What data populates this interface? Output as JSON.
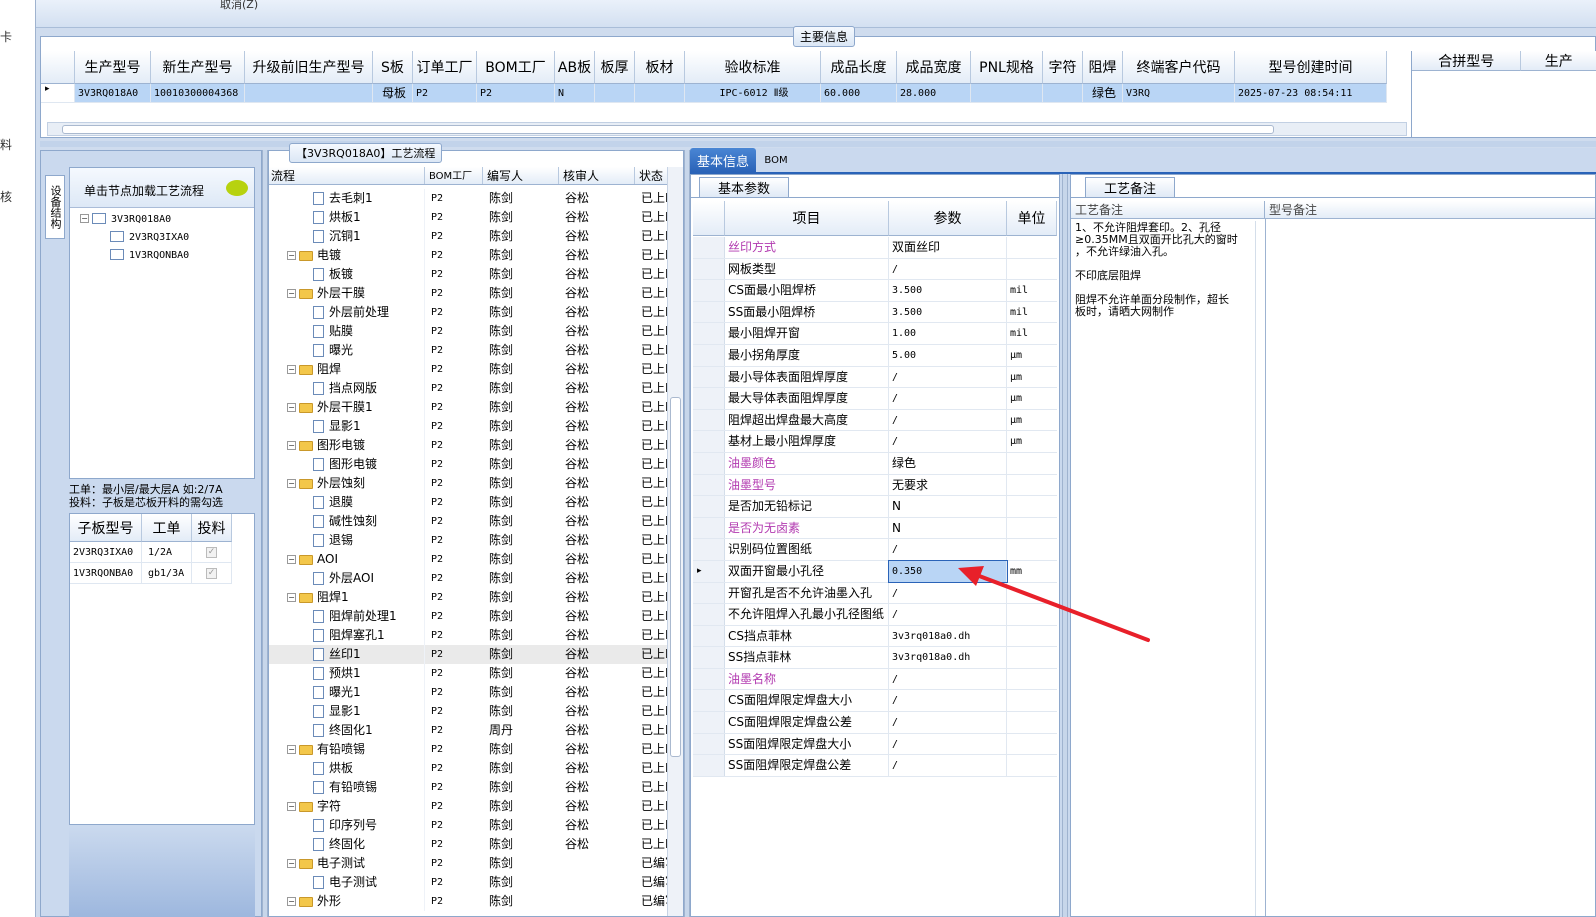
{
  "top": {
    "cancel_label": "取消(Z)"
  },
  "left_strip": {
    "items": [
      "卡",
      "料",
      "核"
    ]
  },
  "main_info": {
    "title": "主要信息",
    "columns": [
      "生产型号",
      "新生产型号",
      "升级前旧生产型号",
      "S板",
      "订单工厂",
      "BOM工厂",
      "AB板",
      "板厚",
      "板材",
      "验收标准",
      "成品长度",
      "成品宽度",
      "PNL规格",
      "字符",
      "阻焊",
      "终端客户代码",
      "型号创建时间"
    ],
    "row": [
      "3V3RQ018A0",
      "10010300004368",
      "",
      "母板",
      "P2",
      "P2",
      "N",
      "",
      "",
      "IPC-6012 Ⅱ级",
      "60.000",
      "28.000",
      "",
      "",
      "绿色",
      "V3RQ",
      "2025-07-23 08:54:11"
    ],
    "right_columns": [
      "合拼型号",
      "生产"
    ]
  },
  "left_panel": {
    "vtab": "设备结构",
    "load_hint": "单击节点加载工艺流程",
    "tree": [
      "3V3RQ018A0",
      "2V3RQ3IXA0",
      "1V3RQONBA0"
    ],
    "note_line1": "工单：最小层/最大层A 如:2/7A",
    "note_line2": "投料：子板是芯板开料的需勾选",
    "sub_headers": [
      "子板型号",
      "工单",
      "投料"
    ],
    "sub_rows": [
      {
        "model": "2V3RQ3IXA0",
        "order": "1/2A"
      },
      {
        "model": "1V3RQONBA0",
        "order": "gb1/3A"
      }
    ]
  },
  "flow": {
    "title": "【3V3RQ018A0】工艺流程",
    "headers": [
      "流程",
      "BOM工厂",
      "编写人",
      "核审人",
      "状态"
    ],
    "rows": [
      {
        "t": "d",
        "name": "去毛刺1",
        "bom": "P2",
        "w": "陈剑",
        "r": "谷松",
        "s": "已上R"
      },
      {
        "t": "d",
        "name": "烘板1",
        "bom": "P2",
        "w": "陈剑",
        "r": "谷松",
        "s": "已上R"
      },
      {
        "t": "d",
        "name": "沉铜1",
        "bom": "P2",
        "w": "陈剑",
        "r": "谷松",
        "s": "已上R"
      },
      {
        "t": "f",
        "name": "电镀",
        "bom": "P2",
        "w": "陈剑",
        "r": "谷松",
        "s": "已上R"
      },
      {
        "t": "d",
        "name": "板镀",
        "bom": "P2",
        "w": "陈剑",
        "r": "谷松",
        "s": "已上R"
      },
      {
        "t": "f",
        "name": "外层干膜",
        "bom": "P2",
        "w": "陈剑",
        "r": "谷松",
        "s": "已上R"
      },
      {
        "t": "d",
        "name": "外层前处理",
        "bom": "P2",
        "w": "陈剑",
        "r": "谷松",
        "s": "已上R"
      },
      {
        "t": "d",
        "name": "贴膜",
        "bom": "P2",
        "w": "陈剑",
        "r": "谷松",
        "s": "已上R"
      },
      {
        "t": "d",
        "name": "曝光",
        "bom": "P2",
        "w": "陈剑",
        "r": "谷松",
        "s": "已上R"
      },
      {
        "t": "f",
        "name": "阻焊",
        "bom": "P2",
        "w": "陈剑",
        "r": "谷松",
        "s": "已上R"
      },
      {
        "t": "d",
        "name": "挡点网版",
        "bom": "P2",
        "w": "陈剑",
        "r": "谷松",
        "s": "已上R"
      },
      {
        "t": "f",
        "name": "外层干膜1",
        "bom": "P2",
        "w": "陈剑",
        "r": "谷松",
        "s": "已上R"
      },
      {
        "t": "d",
        "name": "显影1",
        "bom": "P2",
        "w": "陈剑",
        "r": "谷松",
        "s": "已上R"
      },
      {
        "t": "f",
        "name": "图形电镀",
        "bom": "P2",
        "w": "陈剑",
        "r": "谷松",
        "s": "已上R"
      },
      {
        "t": "d",
        "name": "图形电镀",
        "bom": "P2",
        "w": "陈剑",
        "r": "谷松",
        "s": "已上R"
      },
      {
        "t": "f",
        "name": "外层蚀刻",
        "bom": "P2",
        "w": "陈剑",
        "r": "谷松",
        "s": "已上R"
      },
      {
        "t": "d",
        "name": "退膜",
        "bom": "P2",
        "w": "陈剑",
        "r": "谷松",
        "s": "已上R"
      },
      {
        "t": "d",
        "name": "碱性蚀刻",
        "bom": "P2",
        "w": "陈剑",
        "r": "谷松",
        "s": "已上R"
      },
      {
        "t": "d",
        "name": "退锡",
        "bom": "P2",
        "w": "陈剑",
        "r": "谷松",
        "s": "已上R"
      },
      {
        "t": "f",
        "name": "AOI",
        "bom": "P2",
        "w": "陈剑",
        "r": "谷松",
        "s": "已上R"
      },
      {
        "t": "d",
        "name": "外层AOI",
        "bom": "P2",
        "w": "陈剑",
        "r": "谷松",
        "s": "已上R"
      },
      {
        "t": "f",
        "name": "阻焊1",
        "bom": "P2",
        "w": "陈剑",
        "r": "谷松",
        "s": "已上R"
      },
      {
        "t": "d",
        "name": "阻焊前处理1",
        "bom": "P2",
        "w": "陈剑",
        "r": "谷松",
        "s": "已上R"
      },
      {
        "t": "d",
        "name": "阻焊塞孔1",
        "bom": "P2",
        "w": "陈剑",
        "r": "谷松",
        "s": "已上R"
      },
      {
        "t": "d",
        "name": "丝印1",
        "bom": "P2",
        "w": "陈剑",
        "r": "谷松",
        "s": "已上R",
        "sel": true
      },
      {
        "t": "d",
        "name": "预烘1",
        "bom": "P2",
        "w": "陈剑",
        "r": "谷松",
        "s": "已上R"
      },
      {
        "t": "d",
        "name": "曝光1",
        "bom": "P2",
        "w": "陈剑",
        "r": "谷松",
        "s": "已上R"
      },
      {
        "t": "d",
        "name": "显影1",
        "bom": "P2",
        "w": "陈剑",
        "r": "谷松",
        "s": "已上R"
      },
      {
        "t": "d",
        "name": "终固化1",
        "bom": "P2",
        "w": "周丹",
        "r": "谷松",
        "s": "已上R"
      },
      {
        "t": "f",
        "name": "有铅喷锡",
        "bom": "P2",
        "w": "陈剑",
        "r": "谷松",
        "s": "已上R"
      },
      {
        "t": "d",
        "name": "烘板",
        "bom": "P2",
        "w": "陈剑",
        "r": "谷松",
        "s": "已上R"
      },
      {
        "t": "d",
        "name": "有铅喷锡",
        "bom": "P2",
        "w": "陈剑",
        "r": "谷松",
        "s": "已上R"
      },
      {
        "t": "f",
        "name": "字符",
        "bom": "P2",
        "w": "陈剑",
        "r": "谷松",
        "s": "已上R"
      },
      {
        "t": "d",
        "name": "印序列号",
        "bom": "P2",
        "w": "陈剑",
        "r": "谷松",
        "s": "已上R"
      },
      {
        "t": "d",
        "name": "终固化",
        "bom": "P2",
        "w": "陈剑",
        "r": "谷松",
        "s": "已上R"
      },
      {
        "t": "f",
        "name": "电子测试",
        "bom": "P2",
        "w": "陈剑",
        "r": "",
        "s": "已编写"
      },
      {
        "t": "d",
        "name": "电子测试",
        "bom": "P2",
        "w": "陈剑",
        "r": "",
        "s": "已编写"
      },
      {
        "t": "f",
        "name": "外形",
        "bom": "P2",
        "w": "陈剑",
        "r": "",
        "s": "已编写"
      }
    ]
  },
  "info": {
    "tab_basic": "基本信息",
    "tab_bom": "BOM",
    "subtab": "基本参数",
    "headers": [
      "项目",
      "参数",
      "单位"
    ],
    "params": [
      {
        "name": "丝印方式",
        "value": "双面丝印",
        "unit": "",
        "hl": true
      },
      {
        "name": "网板类型",
        "value": "/",
        "unit": ""
      },
      {
        "name": "CS面最小阻焊桥",
        "value": "3.500",
        "unit": "mil"
      },
      {
        "name": "SS面最小阻焊桥",
        "value": "3.500",
        "unit": "mil"
      },
      {
        "name": "最小阻焊开窗",
        "value": "1.00",
        "unit": "mil"
      },
      {
        "name": "最小拐角厚度",
        "value": "5.00",
        "unit": "μm"
      },
      {
        "name": "最小导体表面阻焊厚度",
        "value": "/",
        "unit": "μm"
      },
      {
        "name": "最大导体表面阻焊厚度",
        "value": "/",
        "unit": "μm"
      },
      {
        "name": "阻焊超出焊盘最大高度",
        "value": "/",
        "unit": "μm"
      },
      {
        "name": "基材上最小阻焊厚度",
        "value": "/",
        "unit": "μm"
      },
      {
        "name": "油墨颜色",
        "value": "绿色",
        "unit": "",
        "hl": true
      },
      {
        "name": "油墨型号",
        "value": "无要求",
        "unit": "",
        "hl": true
      },
      {
        "name": "是否加无铅标记",
        "value": "N",
        "unit": ""
      },
      {
        "name": "是否为无卤素",
        "value": "N",
        "unit": "",
        "hl": true
      },
      {
        "name": "识别码位置图纸",
        "value": "/",
        "unit": ""
      },
      {
        "name": "双面开窗最小孔径",
        "value": "0.350",
        "unit": "mm",
        "sel": true
      },
      {
        "name": "开窗孔是否不允许油墨入孔",
        "value": "/",
        "unit": ""
      },
      {
        "name": "不允许阻焊入孔最小孔径图纸",
        "value": "/",
        "unit": ""
      },
      {
        "name": "CS挡点菲林",
        "value": "3v3rq018a0.dh",
        "unit": ""
      },
      {
        "name": "SS挡点菲林",
        "value": "3v3rq018a0.dh",
        "unit": ""
      },
      {
        "name": "油墨名称",
        "value": "/",
        "unit": "",
        "hl": true
      },
      {
        "name": "CS面阻焊限定焊盘大小",
        "value": "/",
        "unit": ""
      },
      {
        "name": "CS面阻焊限定焊盘公差",
        "value": "/",
        "unit": ""
      },
      {
        "name": "SS面阻焊限定焊盘大小",
        "value": "/",
        "unit": ""
      },
      {
        "name": "SS面阻焊限定焊盘公差",
        "value": "/",
        "unit": ""
      }
    ]
  },
  "remarks": {
    "tab": "工艺备注",
    "col1": "工艺备注",
    "col2": "型号备注",
    "lines": [
      "1、不允许阻焊套印。2、孔径",
      "≥0.35MM且双面开比孔大的窗时",
      "，不允许绿油入孔。",
      "",
      "不印底层阻焊",
      "",
      "阻焊不允许单面分段制作，超长",
      "板时，请晒大网制作"
    ]
  },
  "colors": {
    "accent": "#2a63b8",
    "arrow": "#e8202a",
    "highlight": "#b23ab0"
  }
}
